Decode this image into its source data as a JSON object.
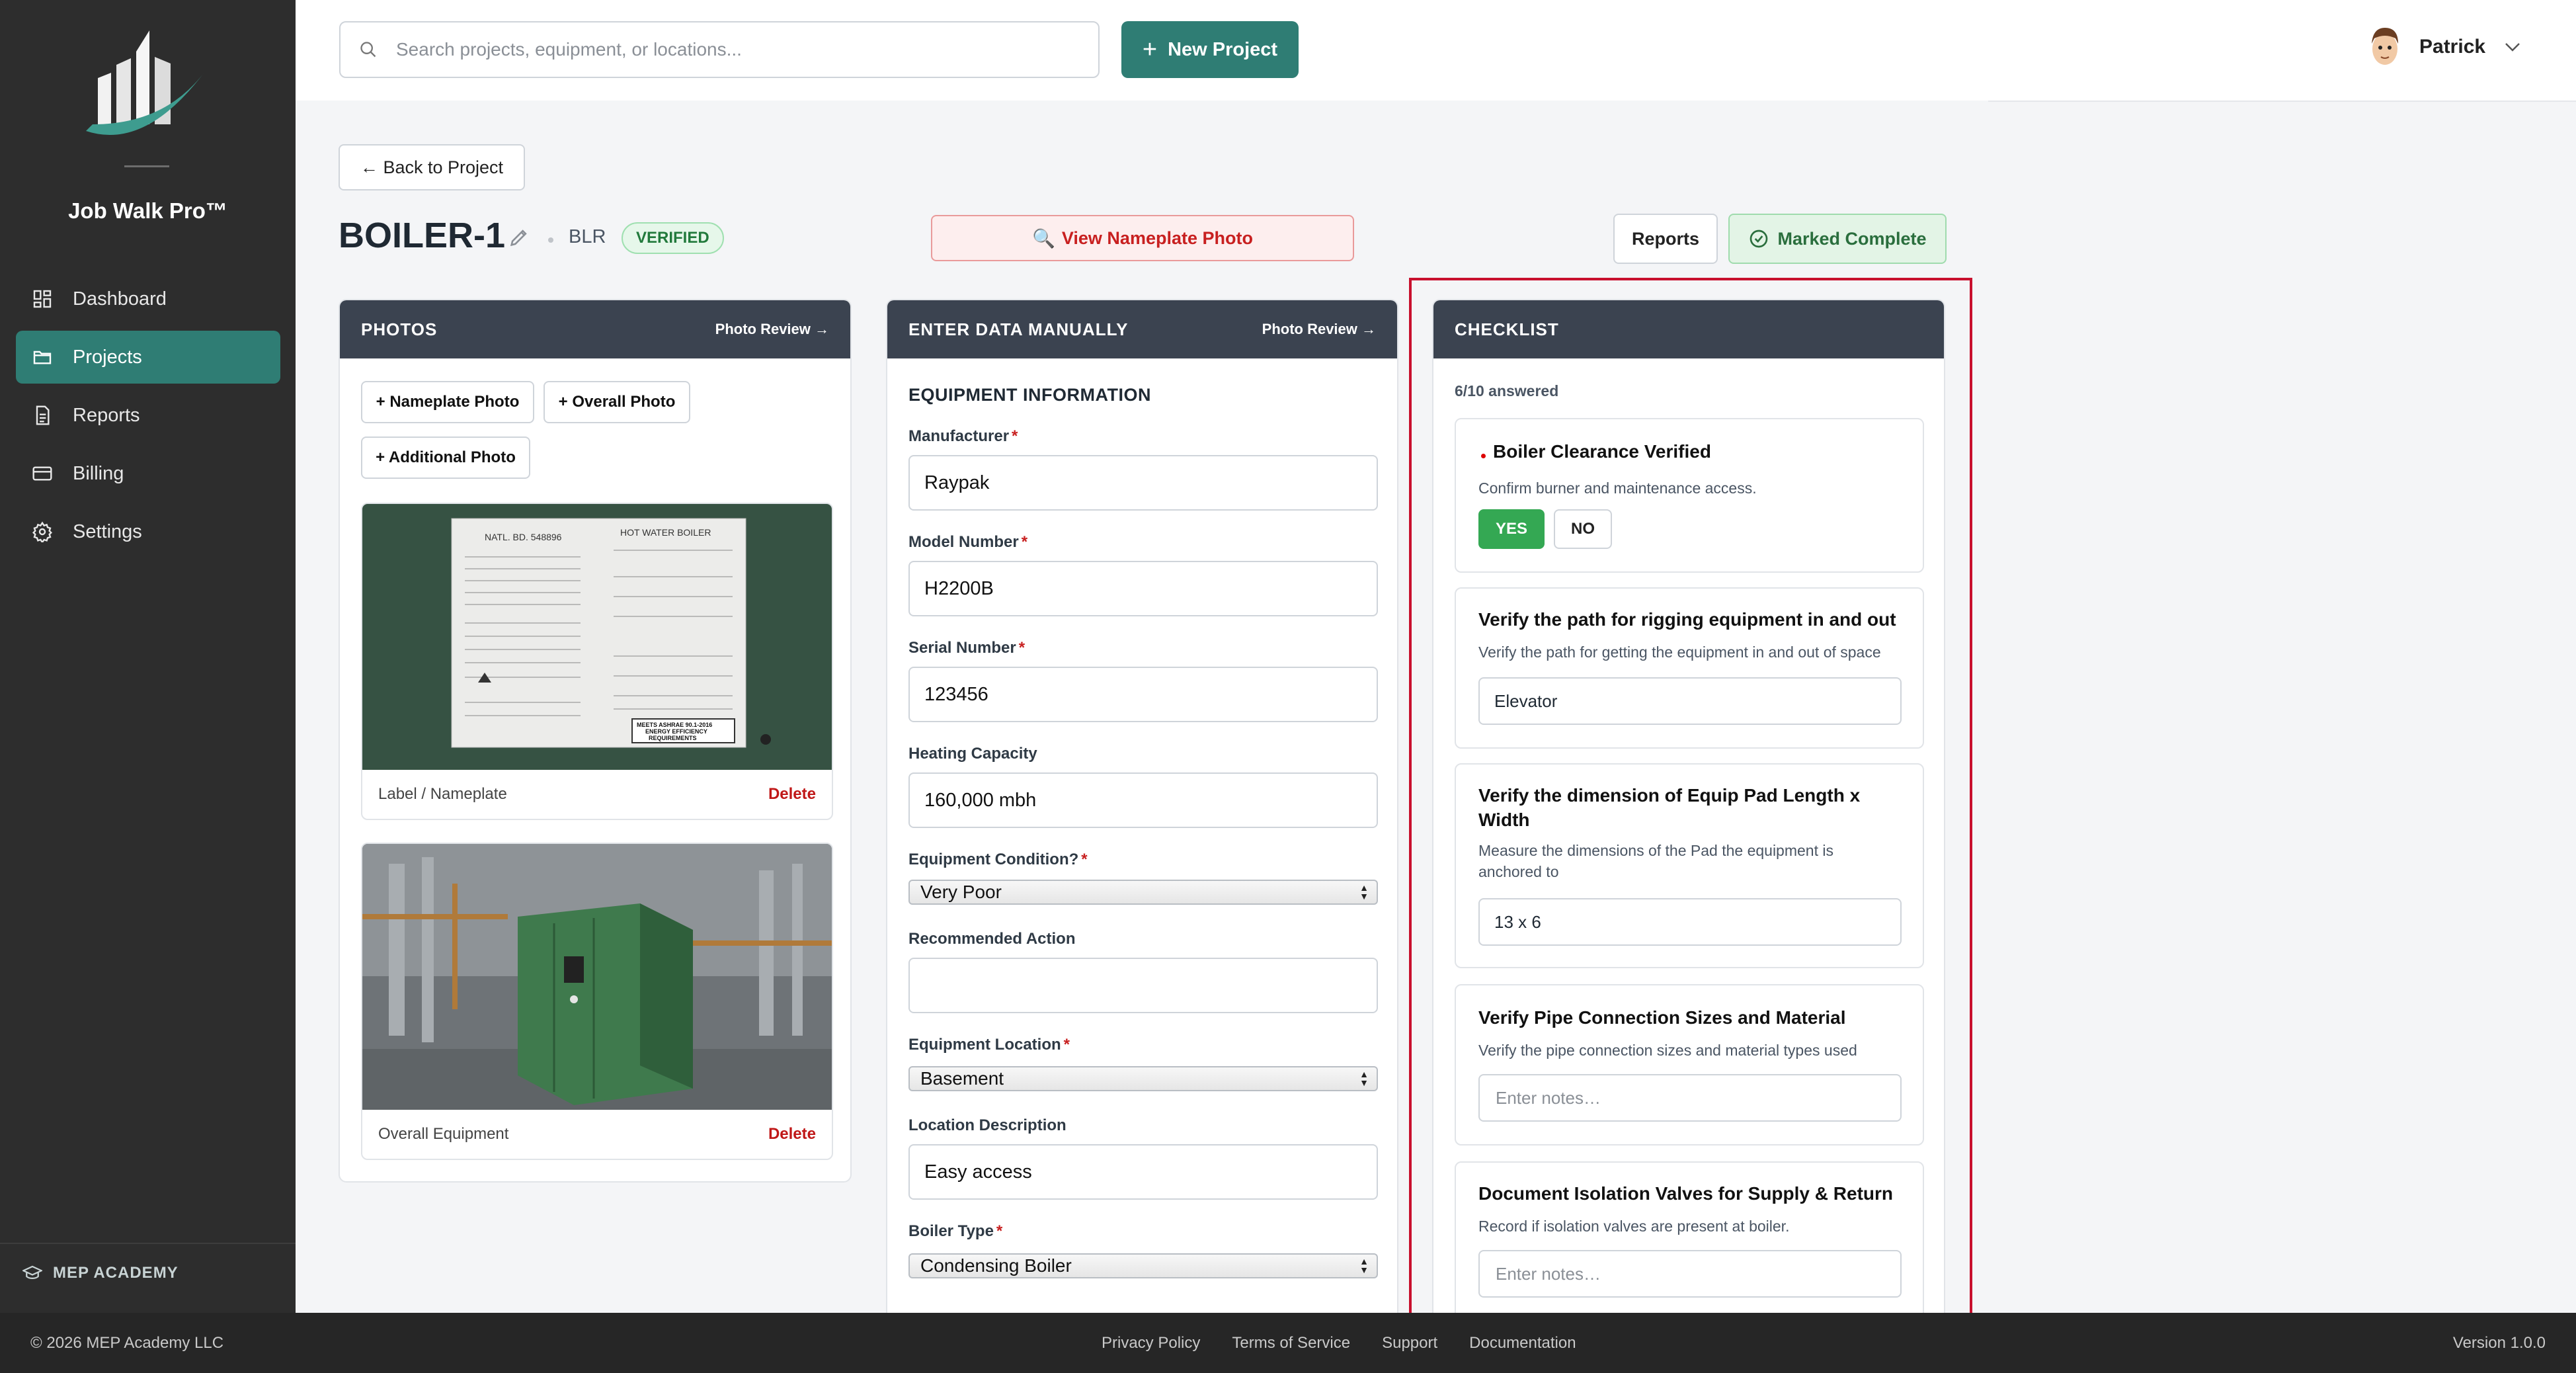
{
  "app": {
    "name": "Job Walk Pro™",
    "academy": "MEP ACADEMY"
  },
  "nav": [
    {
      "label": "Dashboard",
      "icon": "dashboard-icon",
      "active": false
    },
    {
      "label": "Projects",
      "icon": "folder-icon",
      "active": true
    },
    {
      "label": "Reports",
      "icon": "document-icon",
      "active": false
    },
    {
      "label": "Billing",
      "icon": "credit-card-icon",
      "active": false
    },
    {
      "label": "Settings",
      "icon": "gear-icon",
      "active": false
    }
  ],
  "topbar": {
    "search_placeholder": "Search projects, equipment, or locations...",
    "new_project_label": "New Project",
    "user_name": "Patrick"
  },
  "page": {
    "back_label": "← Back to Project",
    "title": "BOILER-1",
    "type_code": "BLR",
    "status_badge": "VERIFIED",
    "nameplate_btn": "View Nameplate Photo",
    "reports_btn": "Reports",
    "complete_btn": "Marked Complete"
  },
  "photos_panel": {
    "title": "PHOTOS",
    "review_link": "Photo Review →",
    "buttons": [
      "+ Nameplate Photo",
      "+ Overall Photo",
      "+ Additional Photo"
    ],
    "photos": [
      {
        "caption": "Label / Nameplate",
        "delete": "Delete"
      },
      {
        "caption": "Overall Equipment",
        "delete": "Delete"
      }
    ],
    "nameplate_text": {
      "natl_bd": "NATL. BD. 548896",
      "title": "HOT WATER BOILER",
      "ashrae_1": "MEETS ASHRAE 90.1-2016",
      "ashrae_2": "ENERGY EFFICIENCY",
      "ashrae_3": "REQUIREMENTS"
    }
  },
  "manual_panel": {
    "title": "ENTER DATA MANUALLY",
    "review_link": "Photo Review →",
    "section": "EQUIPMENT INFORMATION",
    "fields": {
      "manufacturer": {
        "label": "Manufacturer",
        "value": "Raypak"
      },
      "model": {
        "label": "Model Number",
        "value": "H2200B"
      },
      "serial": {
        "label": "Serial Number",
        "value": "123456"
      },
      "capacity": {
        "label": "Heating Capacity",
        "value": "160,000 mbh"
      },
      "condition": {
        "label": "Equipment Condition?",
        "value": "Very Poor"
      },
      "action": {
        "label": "Recommended Action",
        "value": ""
      },
      "location": {
        "label": "Equipment Location",
        "value": "Basement"
      },
      "loc_desc": {
        "label": "Location Description",
        "value": "Easy access"
      },
      "boiler_type": {
        "label": "Boiler Type",
        "value": "Condensing Boiler"
      }
    }
  },
  "checklist": {
    "title": "CHECKLIST",
    "answered": "6/10 answered",
    "items": [
      {
        "title": "Boiler Clearance Verified",
        "desc": "Confirm burner and maintenance access.",
        "yes": "YES",
        "no": "NO"
      },
      {
        "title": "Verify the path for rigging equipment in and out",
        "desc": "Verify the path for getting the equipment in and out of space",
        "value": "Elevator"
      },
      {
        "title": "Verify the dimension of Equip Pad Length x Width",
        "desc": "Measure the dimensions of the Pad the equipment is anchored to",
        "value": "13 x 6"
      },
      {
        "title": "Verify Pipe Connection Sizes and Material",
        "desc": "Verify the pipe connection sizes and material types used",
        "placeholder": "Enter notes…"
      },
      {
        "title": "Document Isolation Valves for Supply & Return",
        "desc": "Record if isolation valves are present at boiler.",
        "placeholder": "Enter notes…"
      }
    ]
  },
  "footer": {
    "copyright": "© 2026 MEP Academy LLC",
    "links": [
      "Privacy Policy",
      "Terms of Service",
      "Support",
      "Documentation"
    ],
    "version": "Version 1.0.0"
  },
  "colors": {
    "accent": "#2f7d74",
    "sidebar": "#2d2d2d",
    "panel_header": "#3b4350",
    "danger": "#c82020",
    "highlight": "#c8102e"
  }
}
